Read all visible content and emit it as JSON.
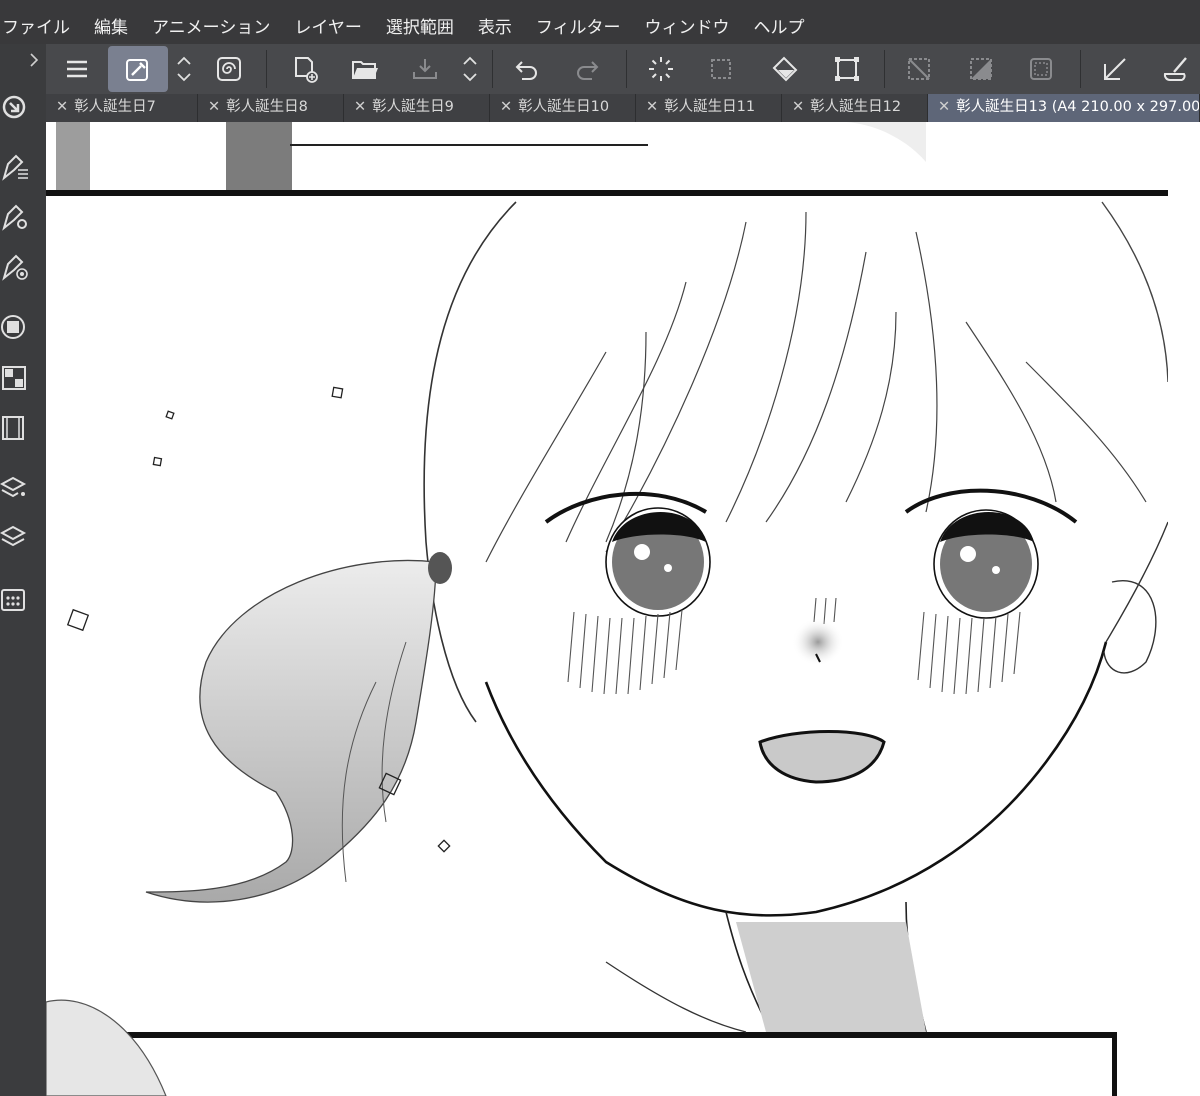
{
  "menubar": {
    "items": [
      "ファイル",
      "編集",
      "アニメーション",
      "レイヤー",
      "選択範囲",
      "表示",
      "フィルター",
      "ウィンドウ",
      "ヘルプ"
    ]
  },
  "tabs": [
    {
      "label": "彰人誕生日7",
      "active": false
    },
    {
      "label": "彰人誕生日8",
      "active": false
    },
    {
      "label": "彰人誕生日9",
      "active": false
    },
    {
      "label": "彰人誕生日10",
      "active": false
    },
    {
      "label": "彰人誕生日11",
      "active": false
    },
    {
      "label": "彰人誕生日12",
      "active": false
    },
    {
      "label": "彰人誕生日13 (A4 210.00 x 297.00",
      "active": true
    }
  ],
  "toolbar": {
    "icons": [
      "menu-icon",
      "eyedropper-icon",
      "spinner-icon",
      "spiral-icon",
      "new-file-icon",
      "open-folder-icon",
      "save-icon",
      "spinner-icon",
      "undo-icon",
      "redo-icon",
      "loading-icon",
      "select-icon",
      "fill-icon",
      "transform-icon",
      "deselect-icon",
      "invert-selection-icon",
      "selection-border-icon",
      "ruler-icon",
      "brush-icon"
    ]
  },
  "colors": {
    "menubar": "#39393b",
    "toolbar": "#48494c",
    "active_tab": "#5e6678",
    "canvas": "#ffffff"
  }
}
